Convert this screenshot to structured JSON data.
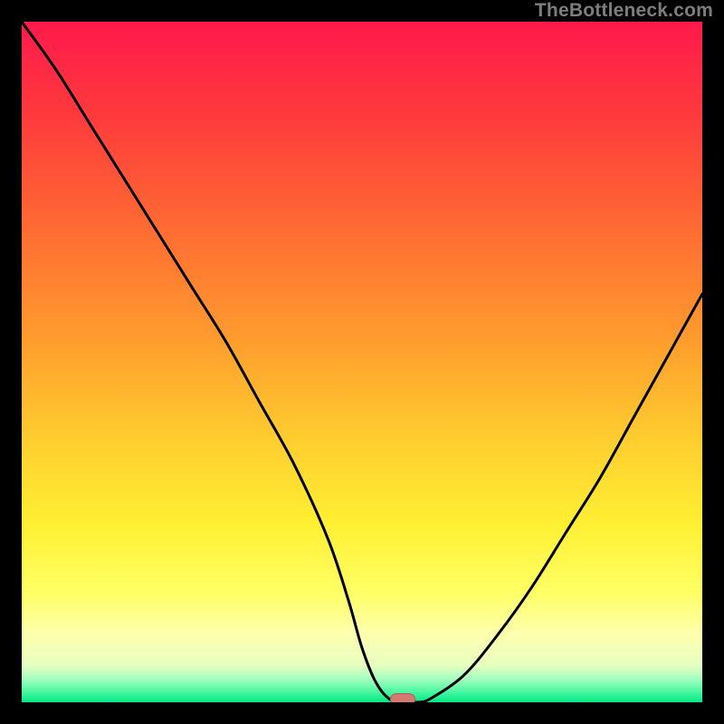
{
  "watermark": "TheBottleneck.com",
  "colors": {
    "black": "#000000",
    "curve": "#000000",
    "marker_fill": "#d57a71",
    "marker_stroke": "#b15b55",
    "gradient_stops": [
      {
        "offset": 0.0,
        "color": "#ff1a4c"
      },
      {
        "offset": 0.14,
        "color": "#ff3a3c"
      },
      {
        "offset": 0.3,
        "color": "#ff6a33"
      },
      {
        "offset": 0.46,
        "color": "#ff9a2e"
      },
      {
        "offset": 0.62,
        "color": "#ffcf2f"
      },
      {
        "offset": 0.74,
        "color": "#fff033"
      },
      {
        "offset": 0.84,
        "color": "#ffff66"
      },
      {
        "offset": 0.9,
        "color": "#fdffae"
      },
      {
        "offset": 0.945,
        "color": "#e8ffc0"
      },
      {
        "offset": 0.965,
        "color": "#a8ffc0"
      },
      {
        "offset": 0.985,
        "color": "#48f7a0"
      },
      {
        "offset": 1.0,
        "color": "#00e887"
      }
    ]
  },
  "chart_data": {
    "type": "line",
    "title": "",
    "xlabel": "",
    "ylabel": "",
    "xlim": [
      0,
      100
    ],
    "ylim": [
      0,
      100
    ],
    "grid": false,
    "series": [
      {
        "name": "bottleneck-curve",
        "x": [
          0,
          5,
          10,
          15,
          20,
          25,
          30,
          35,
          40,
          45,
          48,
          50,
          52,
          54,
          56,
          58,
          60,
          65,
          70,
          75,
          80,
          85,
          90,
          95,
          100
        ],
        "y": [
          100,
          93,
          85,
          77,
          69,
          61,
          53,
          44,
          35,
          24,
          15,
          8,
          3,
          0.5,
          0,
          0,
          0.5,
          4,
          10,
          17,
          25,
          33,
          42,
          51,
          60
        ]
      }
    ],
    "optimal_marker": {
      "x": 56,
      "y": 0
    }
  }
}
